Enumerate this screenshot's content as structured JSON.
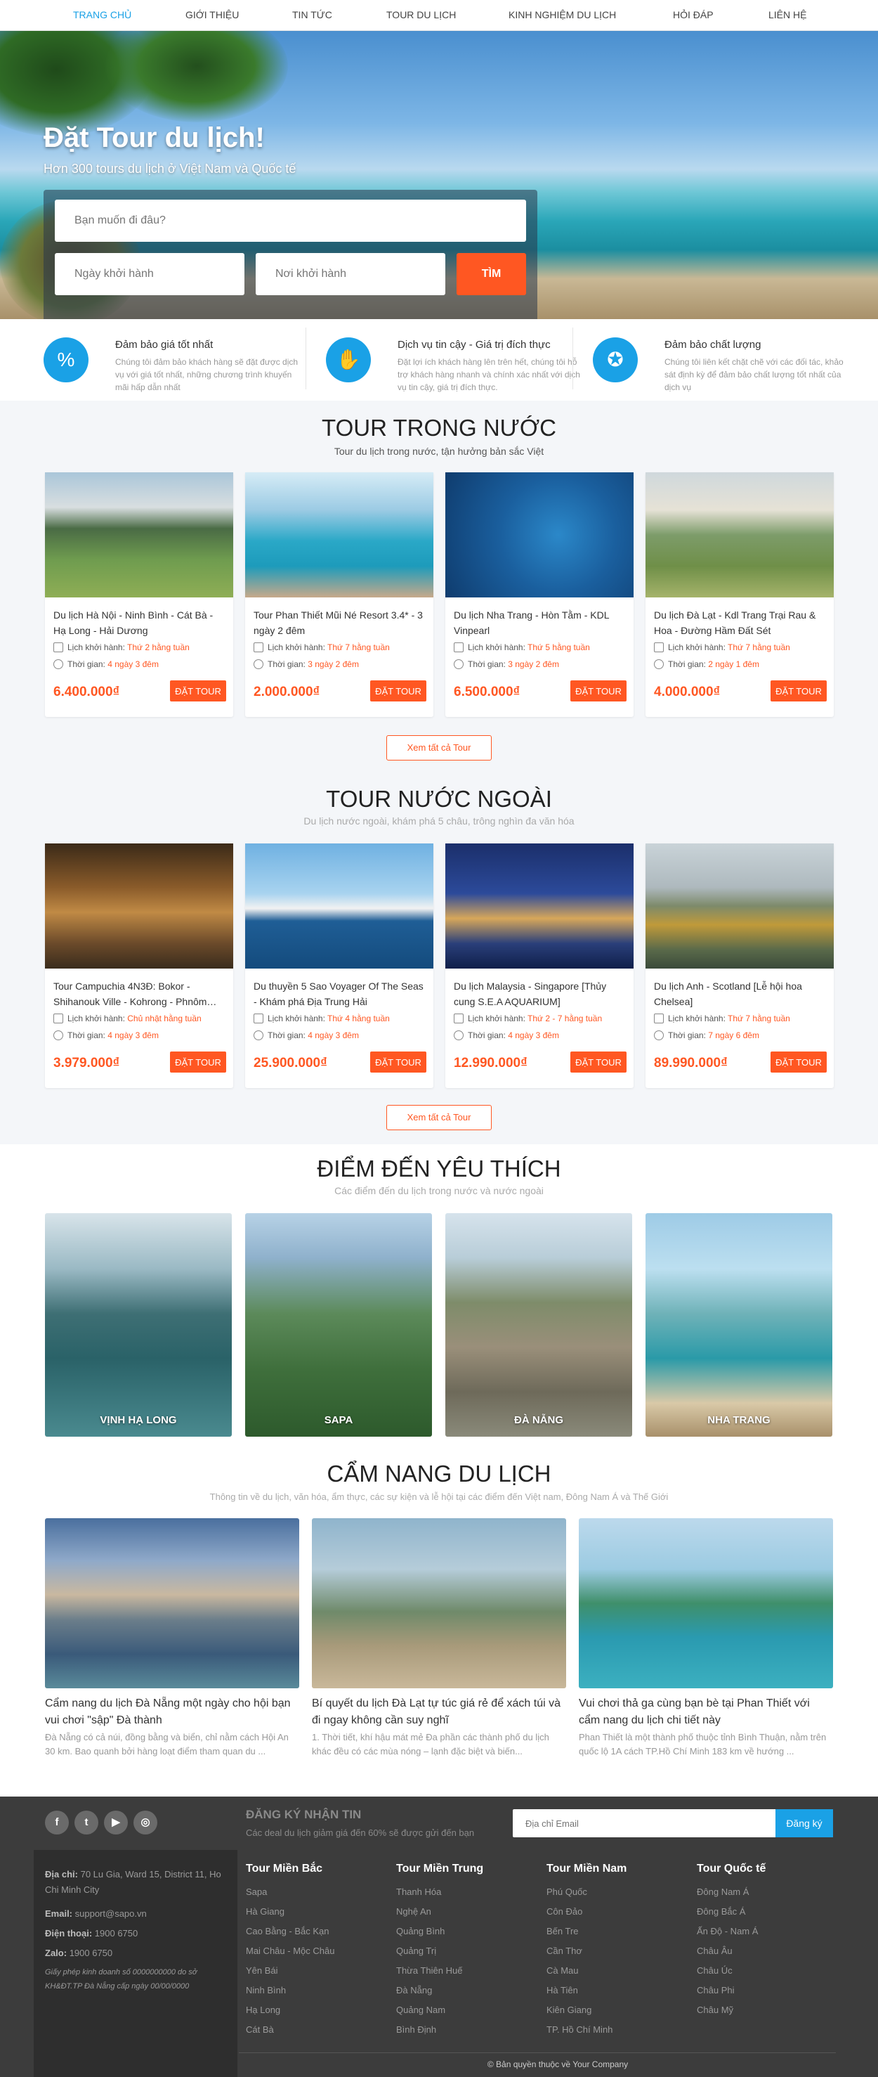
{
  "nav": {
    "items": [
      "TRANG CHỦ",
      "GIỚI THIỆU",
      "TIN TỨC",
      "TOUR DU LỊCH",
      "KINH NGHIỆM DU LỊCH",
      "HỎI ĐÁP",
      "LIÊN HỆ"
    ],
    "active_index": 0
  },
  "hero": {
    "title": "Đặt Tour du lịch!",
    "subtitle": "Hơn 300 tours du lịch ở Việt Nam và Quốc tế",
    "destination_placeholder": "Bạn muốn đi đâu?",
    "date_placeholder": "Ngày khởi hành",
    "origin_placeholder": "Nơi khởi hành",
    "search_label": "TÌM"
  },
  "features": [
    {
      "icon": "price-tag-icon",
      "title": "Đảm bảo giá tốt nhất",
      "desc": "Chúng tôi đảm bảo khách hàng sẽ đặt được dịch vụ với giá tốt nhất, những chương trình khuyến mãi hấp dẫn nhất"
    },
    {
      "icon": "handshake-icon",
      "title": "Dịch vụ tin cậy - Giá trị đích thực",
      "desc": "Đặt lợi ích khách hàng lên trên hết, chúng tôi hỗ trợ khách hàng nhanh và chính xác nhất với dịch vụ tin cậy, giá trị đích thực."
    },
    {
      "icon": "quality-badge-icon",
      "title": "Đảm bảo chất lượng",
      "desc": "Chúng tôi liên kết chặt chẽ với các đối tác, khảo sát định kỳ để đảm bảo chất lượng tốt nhất của dịch vụ"
    }
  ],
  "domestic": {
    "title": "TOUR TRONG NƯỚC",
    "subtitle": "Tour du lịch trong nước, tận hưởng bản sắc Việt",
    "more_label": "Xem tất cả Tour",
    "schedule_label": "Lịch khởi hành:",
    "duration_label": "Thời gian:",
    "book_label": "ĐẶT TOUR",
    "tours": [
      {
        "name": "Du lịch Hà Nội - Ninh Bình - Cát Bà - Hạ Long - Hải Dương",
        "schedule": "Thứ 2 hằng tuần",
        "duration": "4 ngày 3 đêm",
        "price": "6.400.000₫"
      },
      {
        "name": "Tour Phan Thiết Mũi Né Resort 3.4* - 3 ngày 2 đêm",
        "schedule": "Thứ 7 hằng tuần",
        "duration": "3 ngày 2 đêm",
        "price": "2.000.000₫"
      },
      {
        "name": "Du lịch Nha Trang - Hòn Tằm - KDL Vinpearl",
        "schedule": "Thứ 5 hằng tuần",
        "duration": "3 ngày 2 đêm",
        "price": "6.500.000₫"
      },
      {
        "name": "Du lịch Đà Lạt - Kdl Trang Trại Rau & Hoa - Đường Hầm Đất Sét",
        "schedule": "Thứ 7 hằng tuần",
        "duration": "2 ngày 1 đêm",
        "price": "4.000.000₫"
      }
    ]
  },
  "international": {
    "title": "TOUR NƯỚC NGOÀI",
    "subtitle": "Du lịch nước ngoài, khám phá 5 châu, trông nghìn đa văn hóa",
    "more_label": "Xem tất cả Tour",
    "schedule_label": "Lịch khởi hành:",
    "duration_label": "Thời gian:",
    "book_label": "ĐẶT TOUR",
    "tours": [
      {
        "name": "Tour Campuchia 4N3Đ: Bokor - Shihanouk Ville - Kohrong - Phnôm…",
        "schedule": "Chủ nhật hằng tuần",
        "duration": "4 ngày 3 đêm",
        "price": "3.979.000₫"
      },
      {
        "name": "Du thuyền 5 Sao Voyager Of The Seas - Khám phá Địa Trung Hải",
        "schedule": "Thứ 4 hằng tuần",
        "duration": "4 ngày 3 đêm",
        "price": "25.900.000₫"
      },
      {
        "name": "Du lịch Malaysia - Singapore [Thủy cung S.E.A AQUARIUM]",
        "schedule": "Thứ 2 - 7 hằng tuần",
        "duration": "4 ngày 3 đêm",
        "price": "12.990.000₫"
      },
      {
        "name": "Du lịch Anh - Scotland [Lễ hội hoa Chelsea]",
        "schedule": "Thứ 7 hằng tuần",
        "duration": "7 ngày 6 đêm",
        "price": "89.990.000₫"
      }
    ]
  },
  "destinations": {
    "title": "ĐIỂM ĐẾN YÊU THÍCH",
    "subtitle": "Các điểm đến du lịch trong nước và nước ngoài",
    "items": [
      "VỊNH HẠ LONG",
      "SAPA",
      "ĐÀ NẴNG",
      "NHA TRANG"
    ]
  },
  "handbook": {
    "title": "CẨM NANG DU LỊCH",
    "subtitle": "Thông tin về du lịch, văn hóa, ẩm thực, các sự kiện và lễ hội tại các điểm đến Việt nam, Đông Nam Á và Thế Giới",
    "posts": [
      {
        "title": "Cẩm nang du lịch Đà Nẵng một ngày cho hội bạn vui chơi \"sập\" Đà thành",
        "excerpt": "Đà Nẵng có cả núi, đồng bằng và biển, chỉ nằm cách Hội An 30 km. Bao quanh bởi hàng loạt điểm tham quan du ..."
      },
      {
        "title": "Bí quyết du lịch Đà Lạt tự túc giá rẻ để xách túi và đi ngay không cần suy nghĩ",
        "excerpt": "1. Thời tiết, khí hậu mát mẻ Đa phần các thành phố du lịch khác đều có các mùa nóng – lạnh đặc biệt và biến..."
      },
      {
        "title": "Vui chơi thả ga cùng bạn bè tại Phan Thiết với cẩm nang du lịch chi tiết này",
        "excerpt": "Phan Thiết là một thành phố thuộc tỉnh Bình Thuận, nằm trên quốc lộ 1A cách TP.Hồ Chí Minh 183 km về hướng ..."
      }
    ]
  },
  "newsletter": {
    "social": [
      "f",
      "t",
      "▶",
      "◎"
    ],
    "title": "ĐĂNG KÝ NHẬN TIN",
    "desc": "Các deal du lịch giảm giá đến 60% sẽ được gửi đến bạn",
    "email_placeholder": "Địa chỉ Email",
    "subscribe_label": "Đăng ký"
  },
  "footer": {
    "address_label": "Địa chỉ:",
    "address": "70 Lu Gia, Ward 15, District 11, Ho Chi Minh City",
    "email_label": "Email:",
    "email": "support@sapo.vn",
    "phone_label": "Điện thoại:",
    "phone": "1900 6750",
    "zalo_label": "Zalo:",
    "zalo": "1900 6750",
    "license": "Giấy phép kinh doanh số 0000000000 do sở KH&ĐT.TP Đà Nẵng cấp ngày 00/00/0000",
    "columns": [
      {
        "title": "Tour Miền Bắc",
        "links": [
          "Sapa",
          "Hà Giang",
          "Cao Bằng - Bắc Kạn",
          "Mai Châu - Mộc Châu",
          "Yên Bái",
          "Ninh Bình",
          "Hạ Long",
          "Cát Bà"
        ]
      },
      {
        "title": "Tour Miền Trung",
        "links": [
          "Thanh Hóa",
          "Nghệ An",
          "Quảng Bình",
          "Quảng Trị",
          "Thừa Thiên Huế",
          "Đà Nẵng",
          "Quảng Nam",
          "Bình Định"
        ]
      },
      {
        "title": "Tour Miền Nam",
        "links": [
          "Phú Quốc",
          "Côn Đảo",
          "Bến Tre",
          "Cần Thơ",
          "Cà Mau",
          "Hà Tiên",
          "Kiên Giang",
          "TP. Hồ Chí Minh"
        ]
      },
      {
        "title": "Tour Quốc tế",
        "links": [
          "Đông Nam Á",
          "Đông Bắc Á",
          "Ấn Độ - Nam Á",
          "Châu Âu",
          "Châu Úc",
          "Châu Phi",
          "Châu Mỹ"
        ]
      }
    ],
    "copyright": "© Bản quyền thuộc về Your Company"
  }
}
